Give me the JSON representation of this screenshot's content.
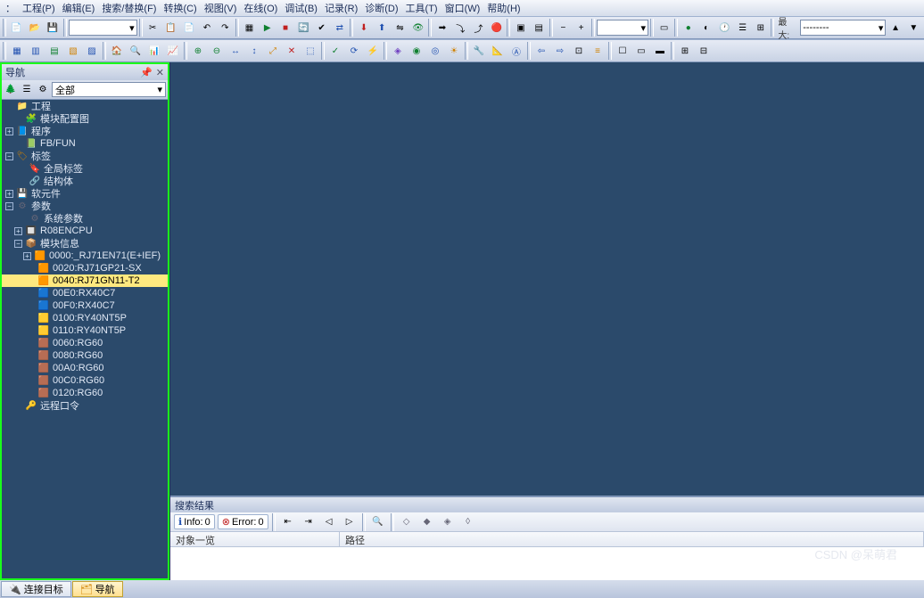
{
  "menu": [
    "工程(P)",
    "编辑(E)",
    "搜索/替换(F)",
    "转换(C)",
    "视图(V)",
    "在线(O)",
    "调试(B)",
    "记录(R)",
    "诊断(D)",
    "工具(T)",
    "窗口(W)",
    "帮助(H)"
  ],
  "toolbar1": {
    "max_label": "最大:",
    "max_value": "--------"
  },
  "nav": {
    "title": "导航",
    "filter": "全部",
    "tree": [
      {
        "ind": 4,
        "exp": null,
        "ico": "📁",
        "cls": "c-org",
        "txt": "工程"
      },
      {
        "ind": 14,
        "exp": null,
        "ico": "🧩",
        "cls": "c-blu",
        "txt": "模块配置图"
      },
      {
        "ind": 4,
        "exp": "+",
        "ico": "📘",
        "cls": "c-blu",
        "txt": "程序"
      },
      {
        "ind": 14,
        "exp": null,
        "ico": "📗",
        "cls": "c-grn",
        "txt": "FB/FUN"
      },
      {
        "ind": 4,
        "exp": "−",
        "ico": "🏷",
        "cls": "c-org",
        "txt": "标签"
      },
      {
        "ind": 18,
        "exp": null,
        "ico": "🔖",
        "cls": "c-org",
        "txt": "全局标签"
      },
      {
        "ind": 18,
        "exp": null,
        "ico": "🔗",
        "cls": "c-org",
        "txt": "结构体"
      },
      {
        "ind": 4,
        "exp": "+",
        "ico": "💾",
        "cls": "c-prp",
        "txt": "软元件"
      },
      {
        "ind": 4,
        "exp": "−",
        "ico": "⚙",
        "cls": "c-gry",
        "txt": "参数"
      },
      {
        "ind": 18,
        "exp": null,
        "ico": "⚙",
        "cls": "c-gry",
        "txt": "系统参数"
      },
      {
        "ind": 14,
        "exp": "+",
        "ico": "🔲",
        "cls": "c-org",
        "txt": "R08ENCPU"
      },
      {
        "ind": 14,
        "exp": "−",
        "ico": "📦",
        "cls": "c-org",
        "txt": "模块信息"
      },
      {
        "ind": 24,
        "exp": "+",
        "ico": "🟧",
        "cls": "c-org",
        "txt": "0000:_RJ71EN71(E+IEF)"
      },
      {
        "ind": 28,
        "exp": null,
        "ico": "🟧",
        "cls": "c-org",
        "txt": "0020:RJ71GP21-SX"
      },
      {
        "ind": 28,
        "exp": null,
        "ico": "🟧",
        "cls": "c-org",
        "txt": "0040:RJ71GN11-T2",
        "sel": true
      },
      {
        "ind": 28,
        "exp": null,
        "ico": "🟦",
        "cls": "c-blu",
        "txt": "00E0:RX40C7"
      },
      {
        "ind": 28,
        "exp": null,
        "ico": "🟦",
        "cls": "c-blu",
        "txt": "00F0:RX40C7"
      },
      {
        "ind": 28,
        "exp": null,
        "ico": "🟨",
        "cls": "c-org",
        "txt": "0100:RY40NT5P"
      },
      {
        "ind": 28,
        "exp": null,
        "ico": "🟨",
        "cls": "c-org",
        "txt": "0110:RY40NT5P"
      },
      {
        "ind": 28,
        "exp": null,
        "ico": "🟫",
        "cls": "c-org",
        "txt": "0060:RG60"
      },
      {
        "ind": 28,
        "exp": null,
        "ico": "🟫",
        "cls": "c-org",
        "txt": "0080:RG60"
      },
      {
        "ind": 28,
        "exp": null,
        "ico": "🟫",
        "cls": "c-org",
        "txt": "00A0:RG60"
      },
      {
        "ind": 28,
        "exp": null,
        "ico": "🟫",
        "cls": "c-org",
        "txt": "00C0:RG60"
      },
      {
        "ind": 28,
        "exp": null,
        "ico": "🟫",
        "cls": "c-org",
        "txt": "0120:RG60"
      },
      {
        "ind": 14,
        "exp": null,
        "ico": "🔑",
        "cls": "c-org",
        "txt": "远程口令"
      }
    ]
  },
  "search": {
    "title": "搜索结果",
    "info_label": "Info:",
    "info_count": "0",
    "error_label": "Error:",
    "error_count": "0",
    "cols": [
      "对象一览",
      "路径"
    ]
  },
  "status": {
    "tab1": "连接目标",
    "tab2": "导航"
  },
  "watermark": "CSDN @呆萌君"
}
